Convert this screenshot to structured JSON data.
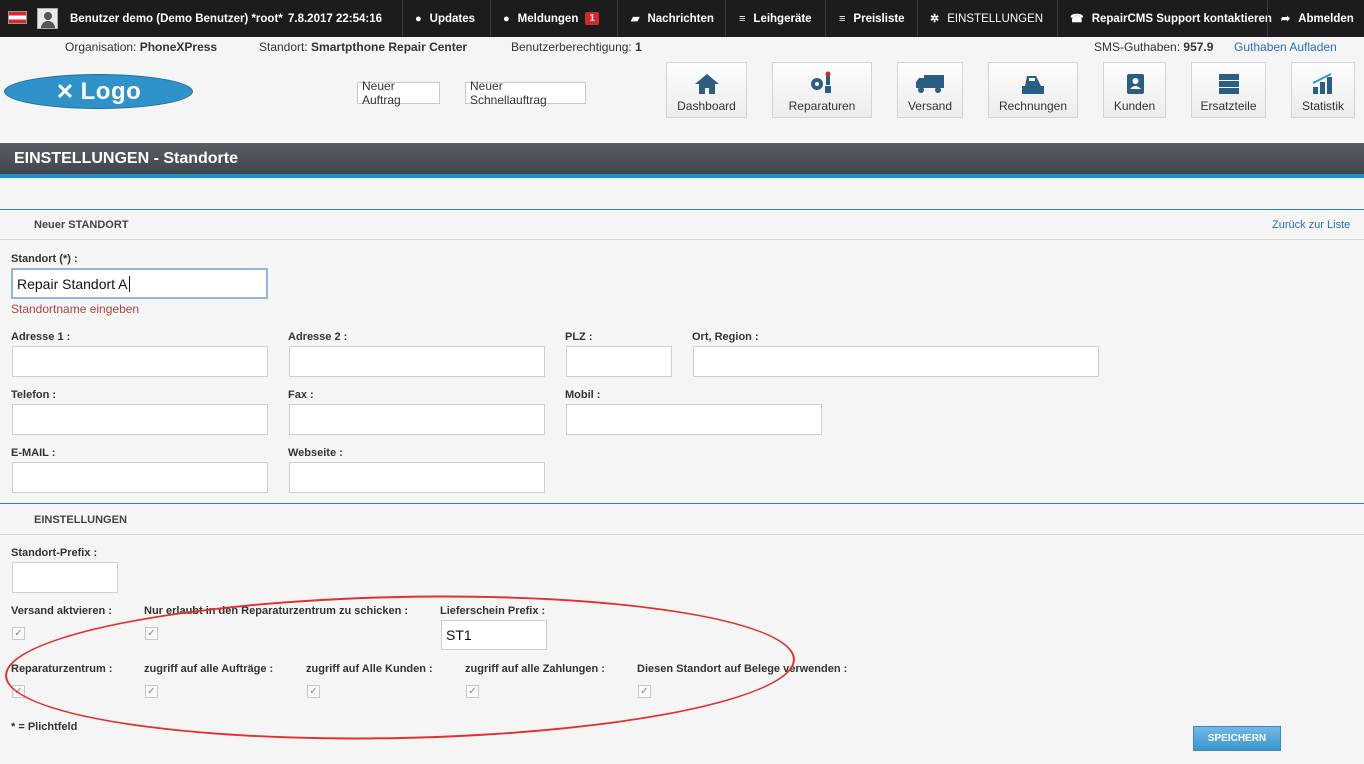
{
  "topbar": {
    "user": "Benutzer demo (Demo Benutzer) *root*",
    "datetime": "7.8.2017 22:54:16",
    "updates": "Updates",
    "meldungen": "Meldungen",
    "meldungen_count": "1",
    "nachrichten": "Nachrichten",
    "leihgeraete": "Leihgeräte",
    "preisliste": "Preisliste",
    "einstellungen": "EINSTELLUNGEN",
    "support": "RepairCMS Support kontaktieren",
    "abmelden": "Abmelden"
  },
  "infobar": {
    "org_label": "Organisation:",
    "org_value": "PhoneXPress",
    "standort_label": "Standort:",
    "standort_value": "Smartpthone Repair Center",
    "berechtigung_label": "Benutzerberechtigung:",
    "berechtigung_value": "1",
    "sms_label": "SMS-Guthaben:",
    "sms_value": "957.9",
    "guthaben_link": "Guthaben Aufladen"
  },
  "logo": {
    "text": "Logo"
  },
  "quick": {
    "neuer_auftrag": "Neuer Auftrag",
    "neuer_schnellauftrag": "Neuer Schnellauftrag"
  },
  "nav": {
    "dashboard": "Dashboard",
    "reparaturen": "Reparaturen",
    "versand": "Versand",
    "rechnungen": "Rechnungen",
    "kunden": "Kunden",
    "ersatzteile": "Ersatzteile",
    "statistik": "Statistik"
  },
  "page_title": "EINSTELLUNGEN - Standorte",
  "form": {
    "section_new": "Neuer STANDORT",
    "back_link": "Zurück zur Liste",
    "standort_label": "Standort (*) :",
    "standort_value": "Repair Standort A",
    "standort_hint": "Standortname eingeben",
    "adresse1_label": "Adresse 1 :",
    "adresse2_label": "Adresse 2 :",
    "plz_label": "PLZ :",
    "ort_label": "Ort, Region :",
    "telefon_label": "Telefon :",
    "fax_label": "Fax :",
    "mobil_label": "Mobil :",
    "email_label": "E-MAIL :",
    "webseite_label": "Webseite :",
    "section_settings": "EINSTELLUNGEN",
    "prefix_label": "Standort-Prefix :",
    "versand_label": "Versand aktvieren :",
    "nur_erlaubt_label": "Nur erlaubt in den Reparaturzentrum zu schicken :",
    "lieferschein_label": "Lieferschein Prefix :",
    "lieferschein_value": "ST1",
    "reparaturzentrum_label": "Reparaturzentrum :",
    "zugriff_auftraege_label": "zugriff auf alle Aufträge :",
    "zugriff_kunden_label": "zugriff auf Alle Kunden :",
    "zugriff_zahlungen_label": "zugriff auf alle Zahlungen :",
    "belege_label": "Diesen Standort auf Belege verwenden :",
    "pflicht_note": "* = Plichtfeld",
    "save_button": "SPEICHERN",
    "check_mark": "✓"
  },
  "colors": {
    "accent": "#1e8fc6",
    "annotation": "#e2302c",
    "hint": "#b0433f"
  }
}
